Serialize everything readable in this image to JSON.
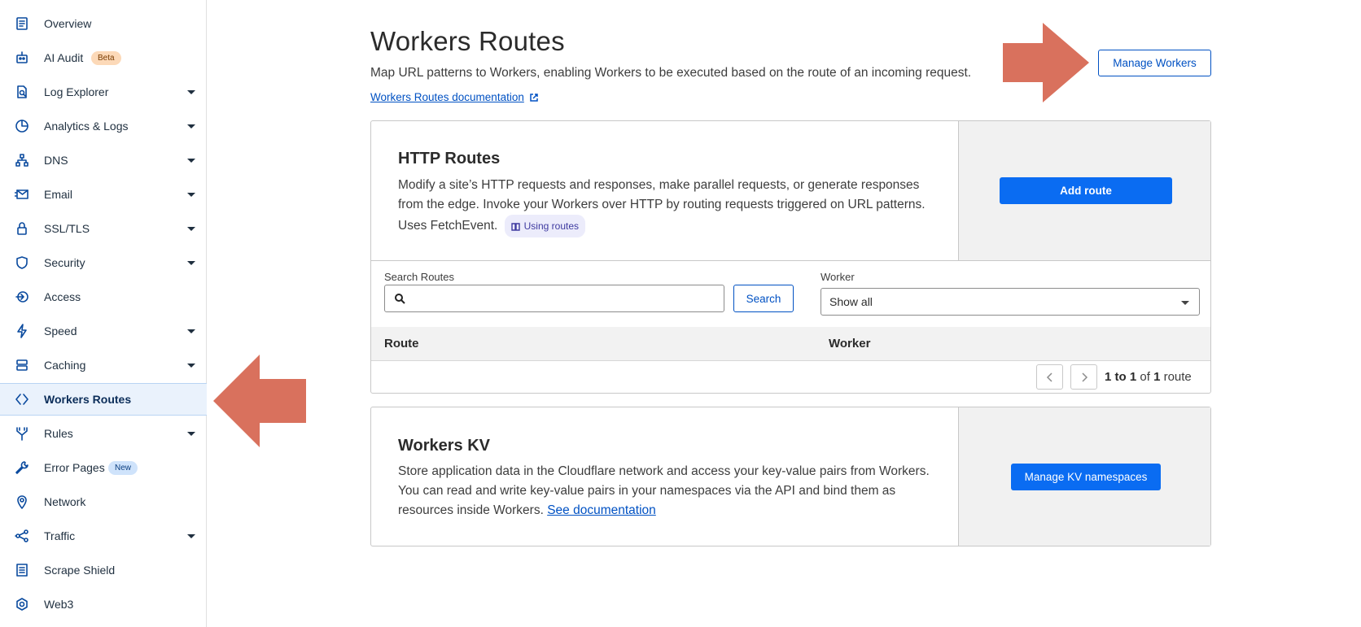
{
  "sidebar": {
    "items": [
      {
        "label": "Overview",
        "icon": "document-icon",
        "caret": false
      },
      {
        "label": "AI Audit",
        "icon": "robot-icon",
        "caret": false,
        "badge": "Beta"
      },
      {
        "label": "Log Explorer",
        "icon": "log-icon",
        "caret": true
      },
      {
        "label": "Analytics & Logs",
        "icon": "pie-chart-icon",
        "caret": true
      },
      {
        "label": "DNS",
        "icon": "network-tree-icon",
        "caret": true
      },
      {
        "label": "Email",
        "icon": "email-icon",
        "caret": true
      },
      {
        "label": "SSL/TLS",
        "icon": "lock-icon",
        "caret": true
      },
      {
        "label": "Security",
        "icon": "shield-icon",
        "caret": true
      },
      {
        "label": "Access",
        "icon": "access-icon",
        "caret": false
      },
      {
        "label": "Speed",
        "icon": "lightning-icon",
        "caret": true
      },
      {
        "label": "Caching",
        "icon": "server-icon",
        "caret": true
      },
      {
        "label": "Workers Routes",
        "icon": "workers-icon",
        "caret": false,
        "active": true
      },
      {
        "label": "Rules",
        "icon": "funnel-icon",
        "caret": true
      },
      {
        "label": "Error Pages",
        "icon": "wrench-icon",
        "caret": false,
        "badge": "New"
      },
      {
        "label": "Network",
        "icon": "location-pin-icon",
        "caret": false
      },
      {
        "label": "Traffic",
        "icon": "traffic-icon",
        "caret": true
      },
      {
        "label": "Scrape Shield",
        "icon": "scrape-shield-icon",
        "caret": false
      },
      {
        "label": "Web3",
        "icon": "web3-icon",
        "caret": false
      }
    ]
  },
  "header": {
    "title": "Workers Routes",
    "subtitle": "Map URL patterns to Workers, enabling Workers to be executed based on the route of an incoming request.",
    "doc_link": "Workers Routes documentation",
    "manage_workers": "Manage Workers"
  },
  "http_routes": {
    "title": "HTTP Routes",
    "desc_1": "Modify a site’s HTTP requests and responses, make parallel requests, or generate responses from the edge. Invoke your Workers over HTTP by routing requests triggered on URL patterns. Uses FetchEvent.",
    "chip": "Using routes",
    "add_route": "Add route",
    "search_label": "Search Routes",
    "search_placeholder": "",
    "search_button": "Search",
    "worker_label": "Worker",
    "worker_selected": "Show all",
    "columns": [
      "Route",
      "Worker"
    ],
    "pager": {
      "from": "1",
      "to_word": "to",
      "to": "1",
      "of_word": "of",
      "total": "1",
      "unit": "route"
    }
  },
  "workers_kv": {
    "title": "Workers KV",
    "desc": "Store application data in the Cloudflare network and access your key-value pairs from Workers. You can read and write key-value pairs in your namespaces via the API and bind them as resources inside Workers.",
    "link": "See documentation",
    "button": "Manage KV namespaces"
  },
  "colors": {
    "accent": "#0a6cf2",
    "link": "#0051c3",
    "annotation_arrow": "#d9715d",
    "active_bg": "#eaf2fc"
  }
}
